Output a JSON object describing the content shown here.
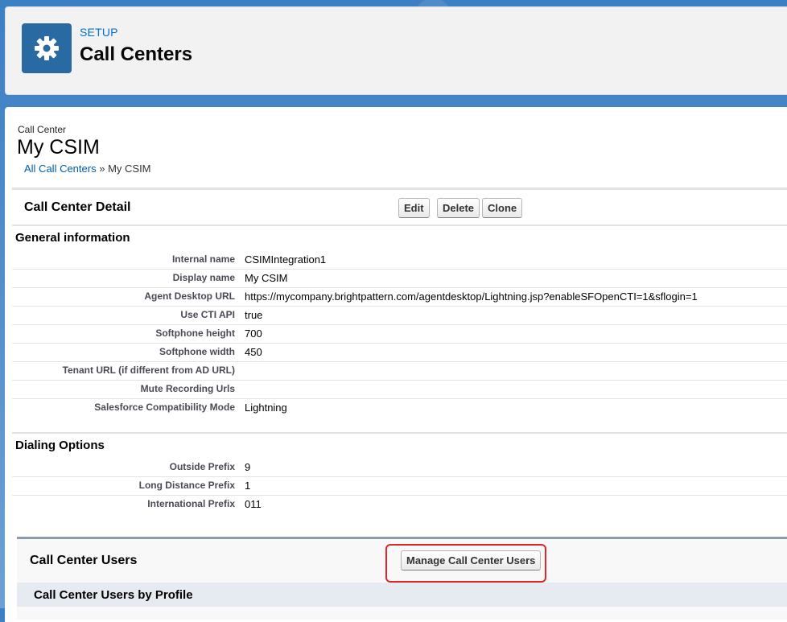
{
  "header": {
    "eyebrow": "SETUP",
    "title": "Call Centers",
    "icon": "gear-icon"
  },
  "record": {
    "type_label": "Call Center",
    "name": "My CSIM",
    "breadcrumb": {
      "link": "All Call Centers",
      "separator": " » ",
      "current": "My CSIM"
    }
  },
  "detail": {
    "title": "Call Center Detail",
    "buttons": {
      "edit": "Edit",
      "delete": "Delete",
      "clone": "Clone"
    }
  },
  "general": {
    "title": "General information",
    "rows": [
      {
        "label": "Internal name",
        "value": "CSIMIntegration1"
      },
      {
        "label": "Display name",
        "value": "My CSIM"
      },
      {
        "label": "Agent Desktop URL",
        "value": "https://mycompany.brightpattern.com/agentdesktop/Lightning.jsp?enableSFOpenCTI=1&sflogin=1"
      },
      {
        "label": "Use CTI API",
        "value": "true"
      },
      {
        "label": "Softphone height",
        "value": "700"
      },
      {
        "label": "Softphone width",
        "value": "450"
      },
      {
        "label": "Tenant URL (if different from AD URL)",
        "value": ""
      },
      {
        "label": "Mute Recording Urls",
        "value": ""
      },
      {
        "label": "Salesforce Compatibility Mode",
        "value": "Lightning"
      }
    ]
  },
  "dialing": {
    "title": "Dialing Options",
    "rows": [
      {
        "label": "Outside Prefix",
        "value": "9"
      },
      {
        "label": "Long Distance Prefix",
        "value": "1"
      },
      {
        "label": "International Prefix",
        "value": "011"
      }
    ]
  },
  "users": {
    "title": "Call Center Users",
    "manage_button": "Manage Call Center Users",
    "by_profile_title": "Call Center Users by Profile"
  },
  "colors": {
    "link": "#015ba7",
    "setup_accent": "#0070d2",
    "icon_bg": "#2a6aa3",
    "highlight": "#e0262b"
  }
}
